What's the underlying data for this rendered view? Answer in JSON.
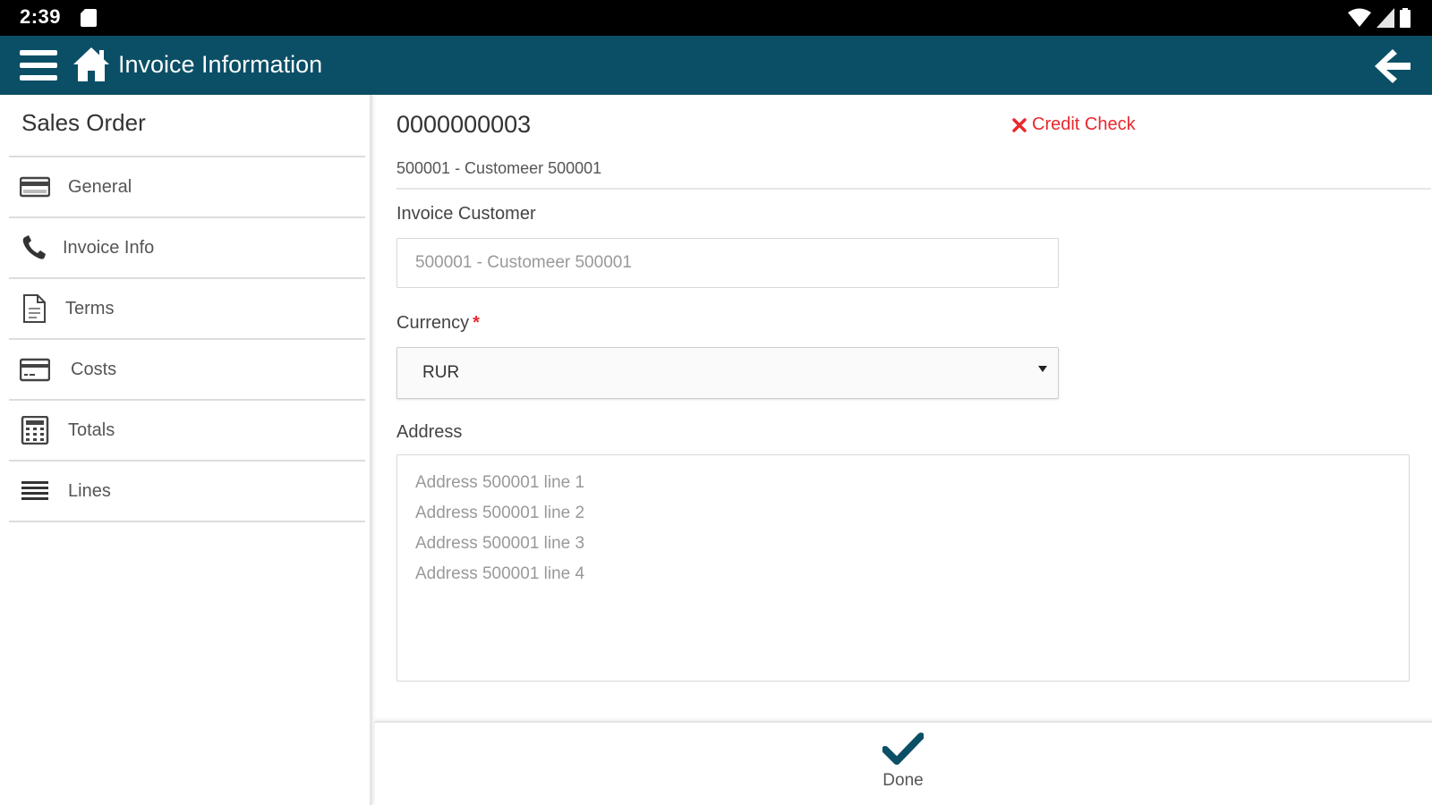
{
  "statusbar": {
    "time": "2:39"
  },
  "appbar": {
    "title": "Invoice Information"
  },
  "sidebar": {
    "heading": "Sales Order",
    "items": [
      {
        "label": "General",
        "icon": "card-icon"
      },
      {
        "label": "Invoice Info",
        "icon": "phone-icon"
      },
      {
        "label": "Terms",
        "icon": "document-icon"
      },
      {
        "label": "Costs",
        "icon": "credit-card-icon"
      },
      {
        "label": "Totals",
        "icon": "calculator-icon"
      },
      {
        "label": "Lines",
        "icon": "list-icon"
      }
    ]
  },
  "main": {
    "order_number": "0000000003",
    "credit_check": "Credit Check",
    "customer_line": "500001 - Customeer 500001",
    "invoice_customer": {
      "label": "Invoice Customer",
      "value": "500001 - Customeer 500001"
    },
    "currency": {
      "label": "Currency",
      "required_mark": "*",
      "value": "RUR"
    },
    "address": {
      "label": "Address",
      "lines": [
        "Address 500001 line 1",
        "Address 500001 line 2",
        "Address 500001 line 3",
        "Address 500001 line 4"
      ]
    }
  },
  "footer": {
    "done_label": "Done"
  },
  "colors": {
    "appbar": "#0b4f66",
    "accent_dark": "#0b4f66",
    "error_red": "#e8282e"
  }
}
